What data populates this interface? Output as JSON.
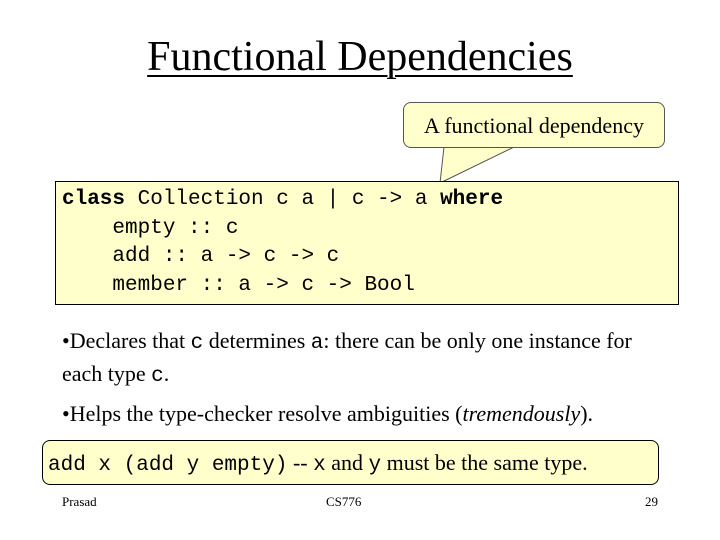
{
  "slide": {
    "title": "Functional Dependencies",
    "callout": {
      "text": "A functional dependency"
    },
    "code": {
      "line1": {
        "kw_class": "class",
        "middle": " Collection c a | c -> a ",
        "kw_where": "where"
      },
      "line2": "    empty :: c",
      "line3": "    add :: a -> c -> c",
      "line4": "    member :: a -> c -> Bool"
    },
    "bullets": [
      {
        "marker": "•",
        "t1": "Declares that ",
        "c1": "c",
        "t2": " determines ",
        "c2": "a",
        "t3": ": there can be only one instance for each type ",
        "c3": "c",
        "t4": "."
      },
      {
        "marker": "•",
        "t1": "Helps the type-checker resolve ambiguities (",
        "em": "tremendously",
        "t2": ")."
      }
    ],
    "example": {
      "code": "add x (add y empty)",
      "dashes": " --",
      "x": "x",
      "and": " and ",
      "y": "y",
      "rest": " must be the same type."
    },
    "footer": {
      "author": "Prasad",
      "course": "CS776",
      "page": "29"
    },
    "colors": {
      "highlight_fill": "#ffffcc",
      "text": "#000000"
    }
  }
}
